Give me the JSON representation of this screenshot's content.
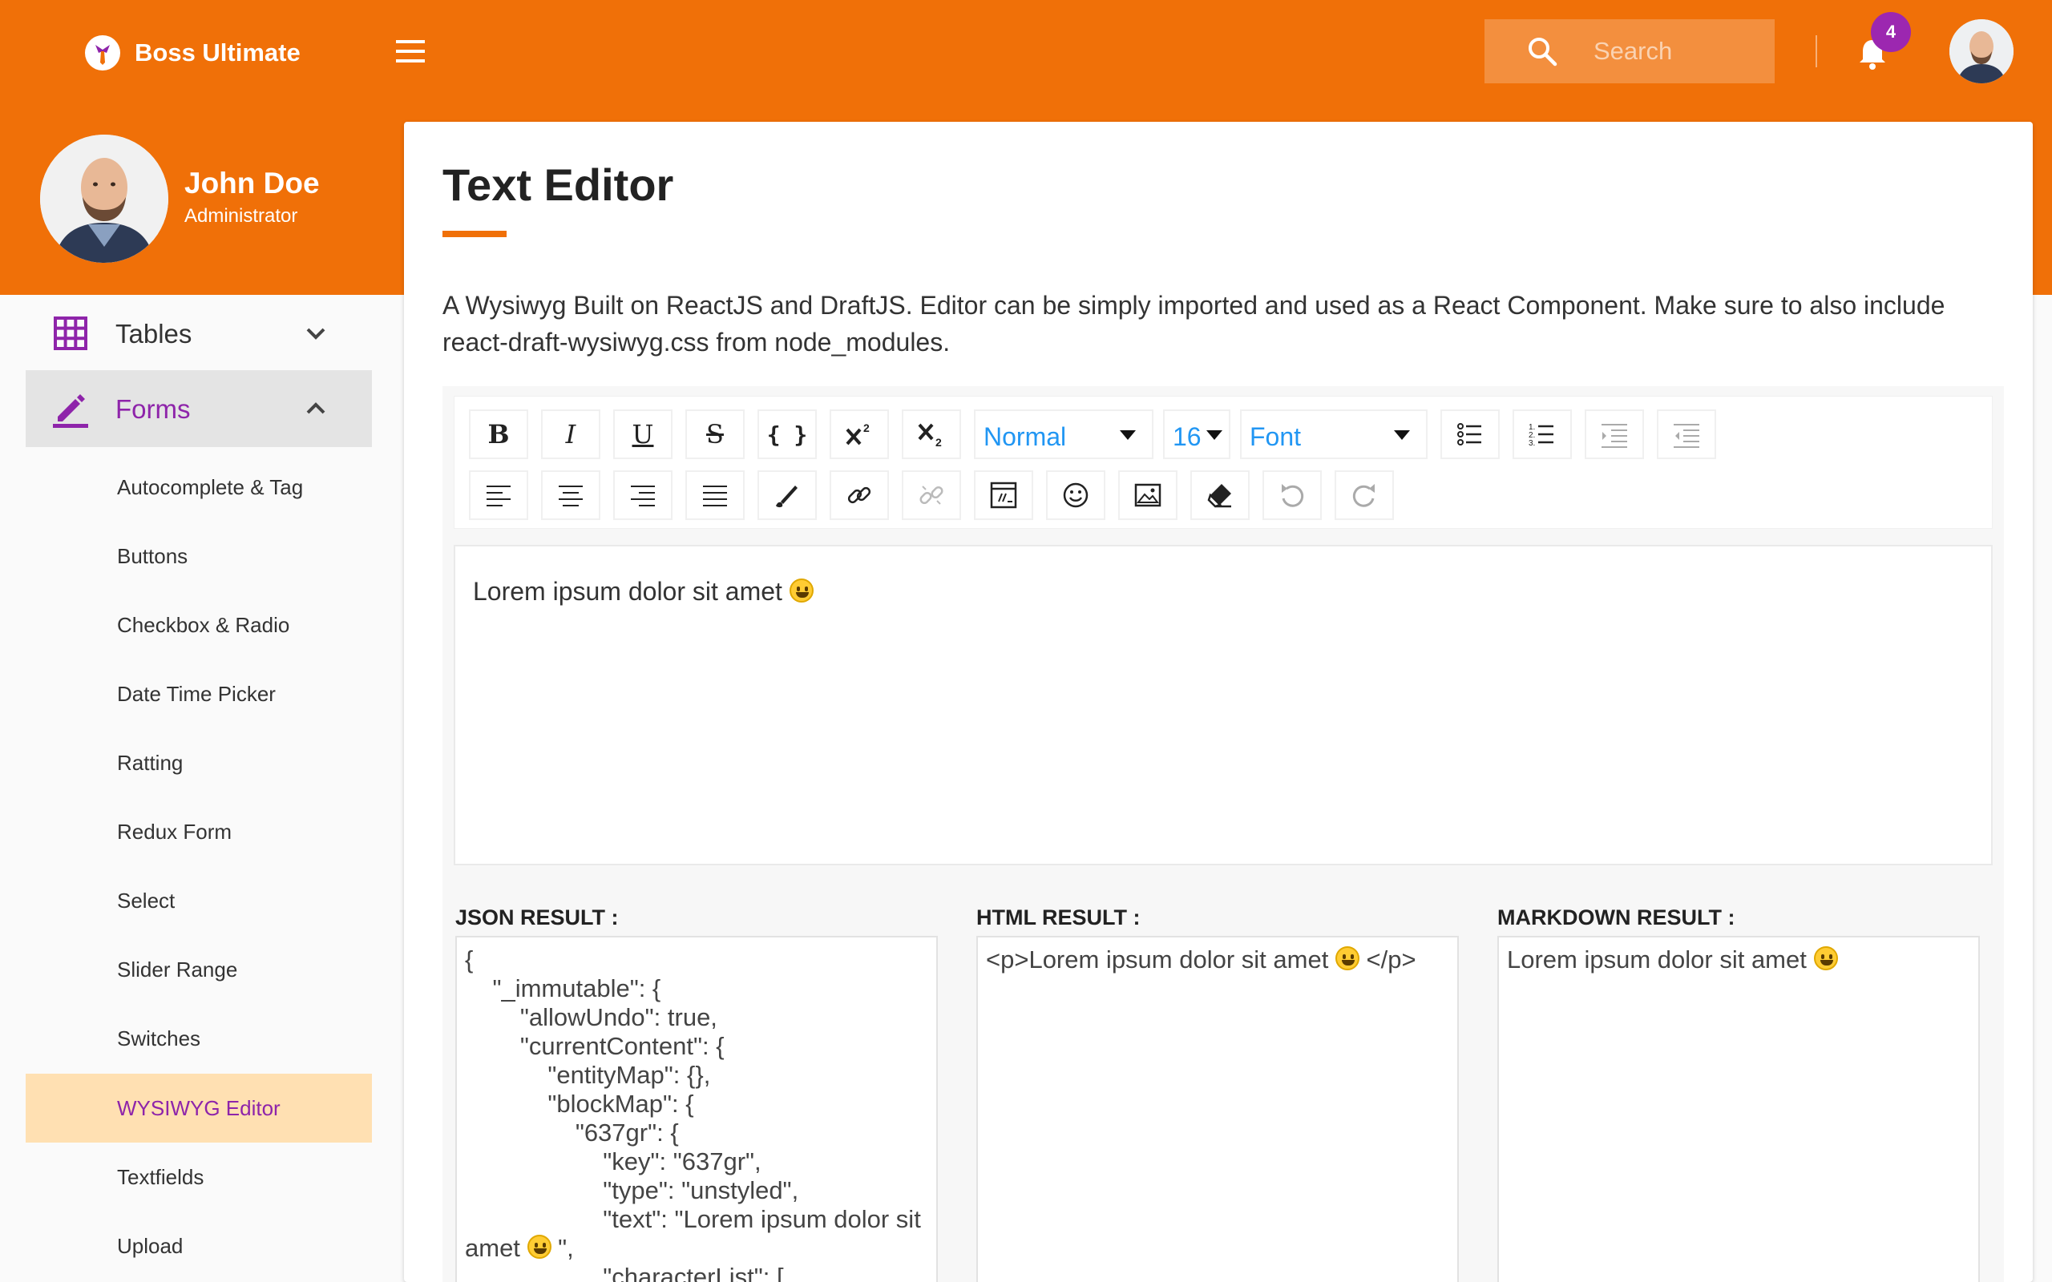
{
  "app": {
    "brand_name": "Boss Ultimate",
    "accent_color": "#f07008",
    "active_color": "#8e24aa",
    "search_placeholder": "Search",
    "notification_count": "4"
  },
  "profile": {
    "name": "John Doe",
    "role": "Administrator"
  },
  "sidebar": {
    "groups": [
      {
        "label": "Tables",
        "icon": "grid-icon",
        "expanded": false
      },
      {
        "label": "Forms",
        "icon": "pencil-icon",
        "expanded": true
      }
    ],
    "items": [
      {
        "label": "Autocomplete & Tag"
      },
      {
        "label": "Buttons"
      },
      {
        "label": "Checkbox & Radio"
      },
      {
        "label": "Date Time Picker"
      },
      {
        "label": "Ratting"
      },
      {
        "label": "Redux Form"
      },
      {
        "label": "Select"
      },
      {
        "label": "Slider Range"
      },
      {
        "label": "Switches"
      },
      {
        "label": "WYSIWYG Editor",
        "active": true
      },
      {
        "label": "Textfields"
      },
      {
        "label": "Upload"
      }
    ]
  },
  "page": {
    "title": "Text Editor",
    "description": "A Wysiwyg Built on ReactJS and DraftJS. Editor can be simply imported and used as a React Component. Make sure to also include react-draft-wysiwyg.css from node_modules."
  },
  "toolbar": {
    "bold": "B",
    "italic": "I",
    "underline": "U",
    "strike": "S",
    "code": "{ }",
    "block_type": "Normal",
    "font_size": "16",
    "font_family": "Font"
  },
  "editor": {
    "content": "Lorem ipsum dolor sit amet"
  },
  "results": {
    "json_label": "JSON RESULT :",
    "html_label": "HTML RESULT :",
    "markdown_label": "MARKDOWN RESULT :",
    "json_text": "{\n    \"_immutable\": {\n        \"allowUndo\": true,\n        \"currentContent\": {\n            \"entityMap\": {},\n            \"blockMap\": {\n                \"637gr\": {\n                    \"key\": \"637gr\",\n                    \"type\": \"unstyled\",\n                    \"text\": \"Lorem ipsum dolor sit amet",
    "json_text_tail": " \",\n                    \"characterList\": [",
    "html_text_pre": "<p>Lorem ipsum dolor sit amet",
    "html_text_post": " </p>",
    "markdown_text": "Lorem ipsum dolor sit amet"
  }
}
